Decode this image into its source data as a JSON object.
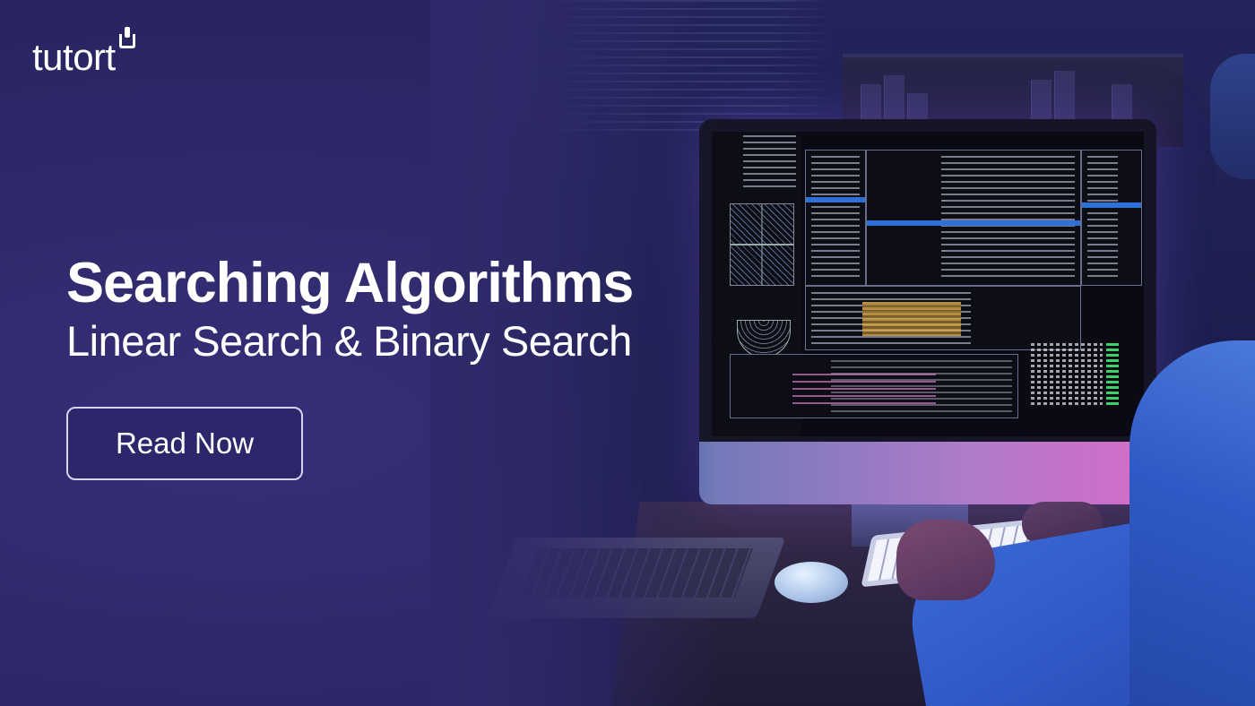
{
  "brand": {
    "logo_text": "tutort"
  },
  "headline": {
    "title": "Searching Algorithms",
    "subtitle": "Linear Search & Binary Search"
  },
  "cta": {
    "label": "Read Now"
  },
  "hero_image": {
    "icon": "developer-at-computer-photo"
  },
  "colors": {
    "background": "#2f2a6a",
    "text": "#ffffff",
    "button_border": "#d7d4ef"
  }
}
